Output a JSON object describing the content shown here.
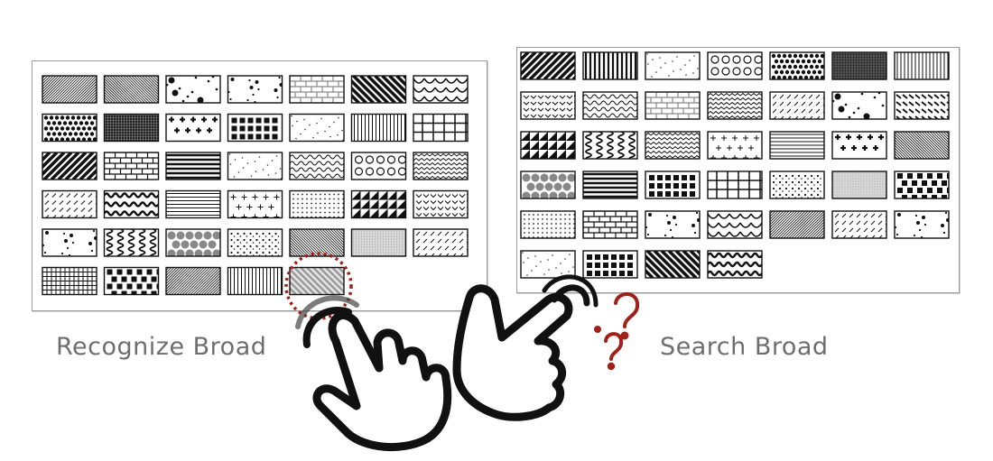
{
  "labels": {
    "recognize": "Recognize Broad",
    "search": "Search Broad"
  },
  "icons": {
    "pointing_hand": "hand-pointing-icon",
    "selection_marker": "dotted-circle-icon",
    "question": "question-mark-icon"
  },
  "colors": {
    "accent": "#a0201a",
    "caption": "#6e6e6e",
    "ink": "#111111",
    "frame": "#9a9a9a"
  },
  "left_grid": [
    [
      "diag-thin",
      "diag-thin-rev",
      "dots-blobs",
      "dots-sparse",
      "brick-gray",
      "diag-bold-rev",
      "scallop"
    ],
    [
      "circles-dense",
      "crosshatch-dense",
      "plus-bold",
      "grid-squares",
      "dots-fine",
      "vlines",
      "grid-open"
    ],
    [
      "diag-bold",
      "brick",
      "hlines-thick",
      "dots-fine",
      "waves",
      "circles-row",
      "zigzag-multi"
    ],
    [
      "dash-diag",
      "waves-bold",
      "hlines",
      "plus-light",
      "dots-grid",
      "triangles",
      "chevron"
    ],
    [
      "dots-sparse",
      "zigzag-vert",
      "circles-big",
      "dots-pairs",
      "diag-thin-rev",
      "stipple",
      "dash-diag"
    ],
    [
      "grid-fine",
      "checker",
      "diag-thin",
      "vlines",
      "highlight-diag"
    ]
  ],
  "right_grid": [
    [
      "diag-bold",
      "vlines-bold",
      "dots-fine",
      "circles-row",
      "circles-dense",
      "crosshatch-dense",
      "vlines"
    ],
    [
      "chevron",
      "waves",
      "brick-gray",
      "zigzag-multi",
      "dash-diag",
      "dots-blobs",
      "dash-diag-bold"
    ],
    [
      "triangles",
      "zigzag-vert",
      "zigzag-multi",
      "plus-light",
      "hlines",
      "plus-bold",
      "diag-thin-rev"
    ],
    [
      "circles-big",
      "hlines-thick",
      "grid-squares",
      "grid-open",
      "dots-pairs",
      "stipple",
      "checker"
    ],
    [
      "dots-grid",
      "brick",
      "dots-sparse",
      "scallop",
      "diag-thin",
      "dash-diag",
      "dots-sparse"
    ],
    [
      "dots-fine",
      "grid-squares",
      "diag-bold-rev",
      "waves-bold"
    ]
  ]
}
